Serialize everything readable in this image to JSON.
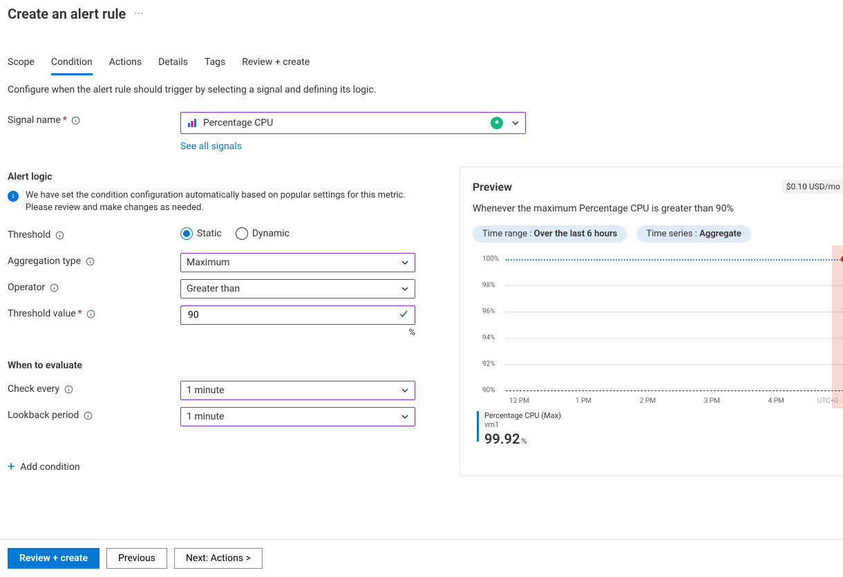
{
  "header": {
    "title": "Create an alert rule"
  },
  "tabs": [
    "Scope",
    "Condition",
    "Actions",
    "Details",
    "Tags",
    "Review + create"
  ],
  "active_tab_index": 1,
  "intro": "Configure when the alert rule should trigger by selecting a signal and defining its logic.",
  "signal": {
    "label": "Signal name",
    "value": "Percentage CPU",
    "see_all": "See all signals"
  },
  "alert_logic": {
    "section": "Alert logic",
    "banner": "We have set the condition configuration automatically based on popular settings for this metric. Please review and make changes as needed.",
    "threshold_label": "Threshold",
    "threshold_options": [
      "Static",
      "Dynamic"
    ],
    "threshold_selected": "Static",
    "aggregation_label": "Aggregation type",
    "aggregation_value": "Maximum",
    "operator_label": "Operator",
    "operator_value": "Greater than",
    "threshold_value_label": "Threshold value",
    "threshold_value": "90",
    "unit": "%"
  },
  "when": {
    "section": "When to evaluate",
    "check_label": "Check every",
    "check_value": "1 minute",
    "lookback_label": "Lookback period",
    "lookback_value": "1 minute"
  },
  "add_condition": "Add condition",
  "preview": {
    "title": "Preview",
    "price": "$0.10 USD/mo",
    "summary": "Whenever the maximum Percentage CPU is greater than 90%",
    "pill1_prefix": "Time range : ",
    "pill1_value": "Over the last 6 hours",
    "pill2_prefix": "Time series : ",
    "pill2_value": "Aggregate",
    "legend_title": "Percentage CPU (Max)",
    "legend_resource": "vm1",
    "legend_value": "99.92",
    "legend_unit": "%"
  },
  "chart_data": {
    "type": "line",
    "title": "",
    "ylabel": "",
    "ylim": [
      90,
      100
    ],
    "y_ticks": [
      90,
      92,
      94,
      96,
      98,
      100
    ],
    "x_ticks": [
      "12 PM",
      "1 PM",
      "2 PM",
      "3 PM",
      "4 PM",
      "UTC+0"
    ],
    "threshold": 90,
    "series": [
      {
        "name": "Percentage CPU (Max)",
        "current": 99.92,
        "color": "#2aa0d8",
        "style": "dotted",
        "approx_constant_value": 100
      }
    ],
    "highlight_band": {
      "x_fraction_start": 0.965,
      "x_fraction_end": 1.0
    }
  },
  "footer": {
    "review": "Review + create",
    "previous": "Previous",
    "next": "Next: Actions >"
  }
}
